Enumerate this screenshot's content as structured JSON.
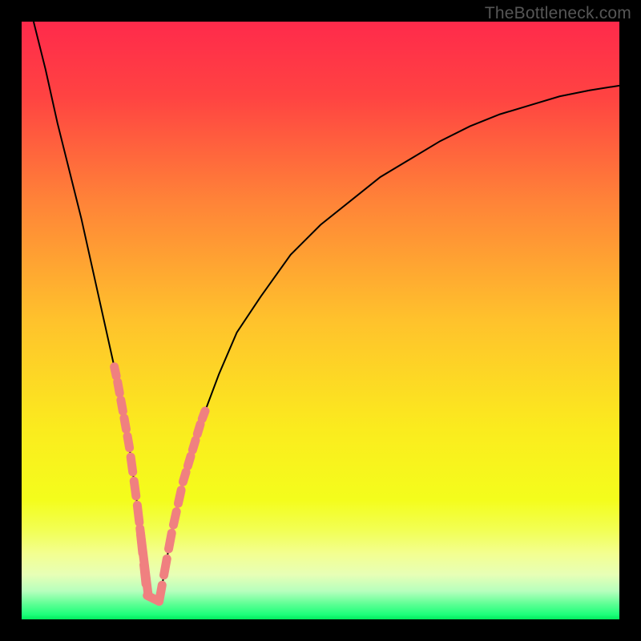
{
  "watermark": {
    "text": "TheBottleneck.com"
  },
  "chart_data": {
    "type": "line",
    "title": "",
    "xlabel": "",
    "ylabel": "",
    "xlim": [
      0,
      100
    ],
    "ylim": [
      0,
      100
    ],
    "gradient_stops": [
      {
        "offset": 0,
        "color": "#ff2a4b"
      },
      {
        "offset": 0.125,
        "color": "#ff4342"
      },
      {
        "offset": 0.3,
        "color": "#ff8338"
      },
      {
        "offset": 0.5,
        "color": "#ffc22c"
      },
      {
        "offset": 0.68,
        "color": "#fbeb1e"
      },
      {
        "offset": 0.8,
        "color": "#f4fd1c"
      },
      {
        "offset": 0.85,
        "color": "#f2ff53"
      },
      {
        "offset": 0.89,
        "color": "#f3ff90"
      },
      {
        "offset": 0.925,
        "color": "#e7ffb6"
      },
      {
        "offset": 0.953,
        "color": "#b6ffbd"
      },
      {
        "offset": 0.975,
        "color": "#5bff93"
      },
      {
        "offset": 0.992,
        "color": "#1dff7a"
      },
      {
        "offset": 1.0,
        "color": "#02ea5e"
      }
    ],
    "series": [
      {
        "name": "curve",
        "x": [
          2,
          4,
          6,
          8,
          10,
          12,
          14,
          16,
          18,
          19.5,
          21,
          23,
          25,
          27,
          30,
          33,
          36,
          40,
          45,
          50,
          55,
          60,
          65,
          70,
          75,
          80,
          85,
          90,
          95,
          100
        ],
        "y": [
          100,
          92,
          83,
          75,
          67,
          58,
          49,
          40,
          29,
          18,
          4,
          3,
          14,
          23,
          33,
          41,
          48,
          54,
          61,
          66,
          70,
          74,
          77,
          80,
          82.5,
          84.5,
          86,
          87.5,
          88.5,
          89.3
        ]
      }
    ],
    "beads": {
      "note": "pink elongated bead markers overlaid on curve near the valley",
      "color": "#f08080",
      "left_segment": {
        "x_range": [
          15.5,
          21.0
        ],
        "count": 10
      },
      "right_segment": {
        "x_range": [
          23.0,
          31.0
        ],
        "count": 10
      }
    }
  }
}
